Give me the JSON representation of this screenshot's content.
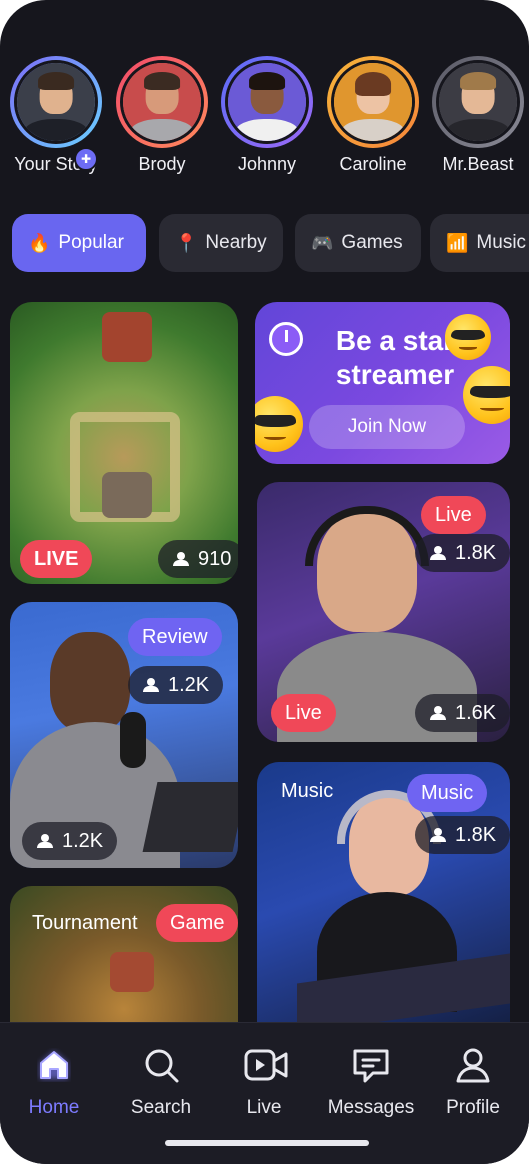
{
  "stories": [
    {
      "name": "Your Story",
      "ring": "linear-gradient(135deg,#7c6cf6,#6ad0ff)",
      "bg": "#3b3f4a",
      "skin": "#e0b28e",
      "hair": "#3a2a20",
      "body": "#1e2028",
      "badge": true
    },
    {
      "name": "Brody",
      "ring": "linear-gradient(135deg,#f24b6a,#ff8a5c)",
      "bg": "#c84c4c",
      "skin": "#d79a7a",
      "hair": "#3b2b22",
      "body": "#a8a8ac"
    },
    {
      "name": "Johnny",
      "ring": "linear-gradient(135deg,#5b6cf6,#9b6af6)",
      "bg": "#6b5ad6",
      "skin": "#8a5a3e",
      "hair": "#1d140f",
      "body": "#f0f0f0"
    },
    {
      "name": "Caroline",
      "ring": "linear-gradient(135deg,#f6b43a,#f6863a)",
      "bg": "#e0962e",
      "skin": "#edc3a4",
      "hair": "#6a3a22",
      "body": "#d8d0c8"
    },
    {
      "name": "Mr.Beast",
      "ring": "linear-gradient(135deg,#5a5a66,#8a8a96)",
      "bg": "#3c3c44",
      "skin": "#e4b896",
      "hair": "#a07a4a",
      "body": "#26262c"
    }
  ],
  "chips": [
    {
      "label": "Popular",
      "icon": "🔥",
      "icon_name": "fire-icon",
      "active": true
    },
    {
      "label": "Nearby",
      "icon": "📍",
      "icon_name": "location-pin-icon",
      "active": false
    },
    {
      "label": "Games",
      "icon": "🎮",
      "icon_name": "gamepad-icon",
      "active": false
    },
    {
      "label": "Music",
      "icon": "📶",
      "icon_name": "music-bars-icon",
      "active": false
    }
  ],
  "cards": {
    "game_live": {
      "badge": "LIVE",
      "viewers": "910"
    },
    "promo": {
      "title": "Be a star streamer",
      "button": "Join Now"
    },
    "streamer_live": {
      "top_badge": "Live",
      "top_viewers": "1.8K",
      "badge": "Live",
      "viewers": "1.6K"
    },
    "review": {
      "badge": "Review",
      "top_viewers": "1.2K",
      "viewers": "1.2K"
    },
    "music": {
      "label": "Music",
      "badge": "Music",
      "viewers": "1.8K"
    },
    "tournament": {
      "label": "Tournament",
      "badge": "Game"
    }
  },
  "nav": [
    {
      "label": "Home",
      "icon": "home-icon",
      "active": true
    },
    {
      "label": "Search",
      "icon": "search-icon",
      "active": false
    },
    {
      "label": "Live",
      "icon": "video-icon",
      "active": false
    },
    {
      "label": "Messages",
      "icon": "message-icon",
      "active": false
    },
    {
      "label": "Profile",
      "icon": "profile-icon",
      "active": false
    }
  ],
  "colors": {
    "background": "#16161d",
    "accent": "#6966f0",
    "live_red": "#f04858",
    "nav_active": "#7d7bff"
  }
}
